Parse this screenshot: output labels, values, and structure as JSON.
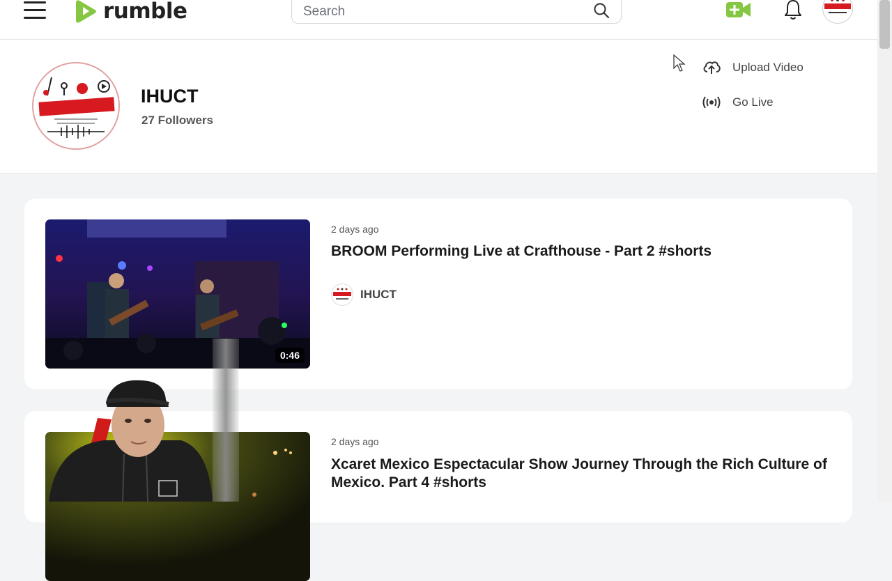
{
  "header": {
    "logo_text": "rumble",
    "search_placeholder": "Search",
    "icons": [
      "menu-icon",
      "rumble-logo-icon",
      "search-icon",
      "upload-camera-icon",
      "bell-icon",
      "user-avatar"
    ]
  },
  "channel": {
    "name": "IHUCT",
    "followers": "27 Followers",
    "actions": {
      "upload": "Upload Video",
      "live": "Go Live"
    }
  },
  "videos": [
    {
      "time": "2 days ago",
      "title": "BROOM Performing Live at Crafthouse - Part 2 #shorts",
      "duration": "0:46",
      "channel": "IHUCT"
    },
    {
      "time": "2 days ago",
      "title": "Xcaret Mexico Espectacular Show Journey Through the Rich Culture of Mexico. Part 4 #shorts"
    }
  ],
  "colors": {
    "brand_green": "#85c742",
    "avatar_red": "#d71920"
  }
}
